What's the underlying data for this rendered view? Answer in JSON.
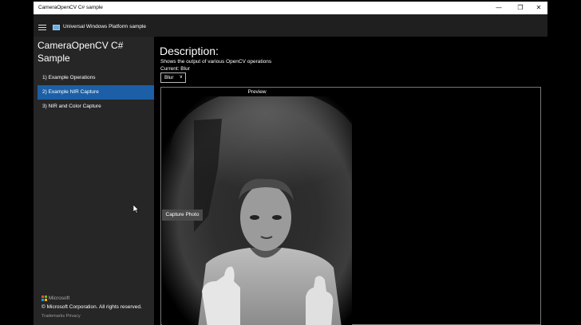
{
  "window": {
    "title": "CameraOpenCV C# sample",
    "controls": {
      "minimize": "—",
      "restore": "❐",
      "close": "✕"
    }
  },
  "header": {
    "app_title": "Universal Windows Platform sample",
    "menu_icon": "hamburger-icon",
    "app_icon": "app-icon"
  },
  "sidebar": {
    "title": "CameraOpenCV C# Sample",
    "items": [
      {
        "label": "1) Example Operations",
        "selected": false
      },
      {
        "label": "2) Example NIR Capture",
        "selected": true
      },
      {
        "label": "3) NIR and Color Capture",
        "selected": false
      }
    ],
    "selected_color": "#1c5fa6",
    "footer": {
      "brand": "Microsoft",
      "copyright": "© Microsoft Corporation. All rights reserved.",
      "links": [
        "Trademarks",
        "Privacy"
      ]
    }
  },
  "main": {
    "description_header": "Description:",
    "description": "Shows the output of various OpenCV operations",
    "current_label": "Current: Blur",
    "operation_select": {
      "value": "Blur",
      "chevron_icon": "chevron-down-icon"
    },
    "preview": {
      "label": "Preview",
      "capture_button": "Capture Photo"
    }
  }
}
